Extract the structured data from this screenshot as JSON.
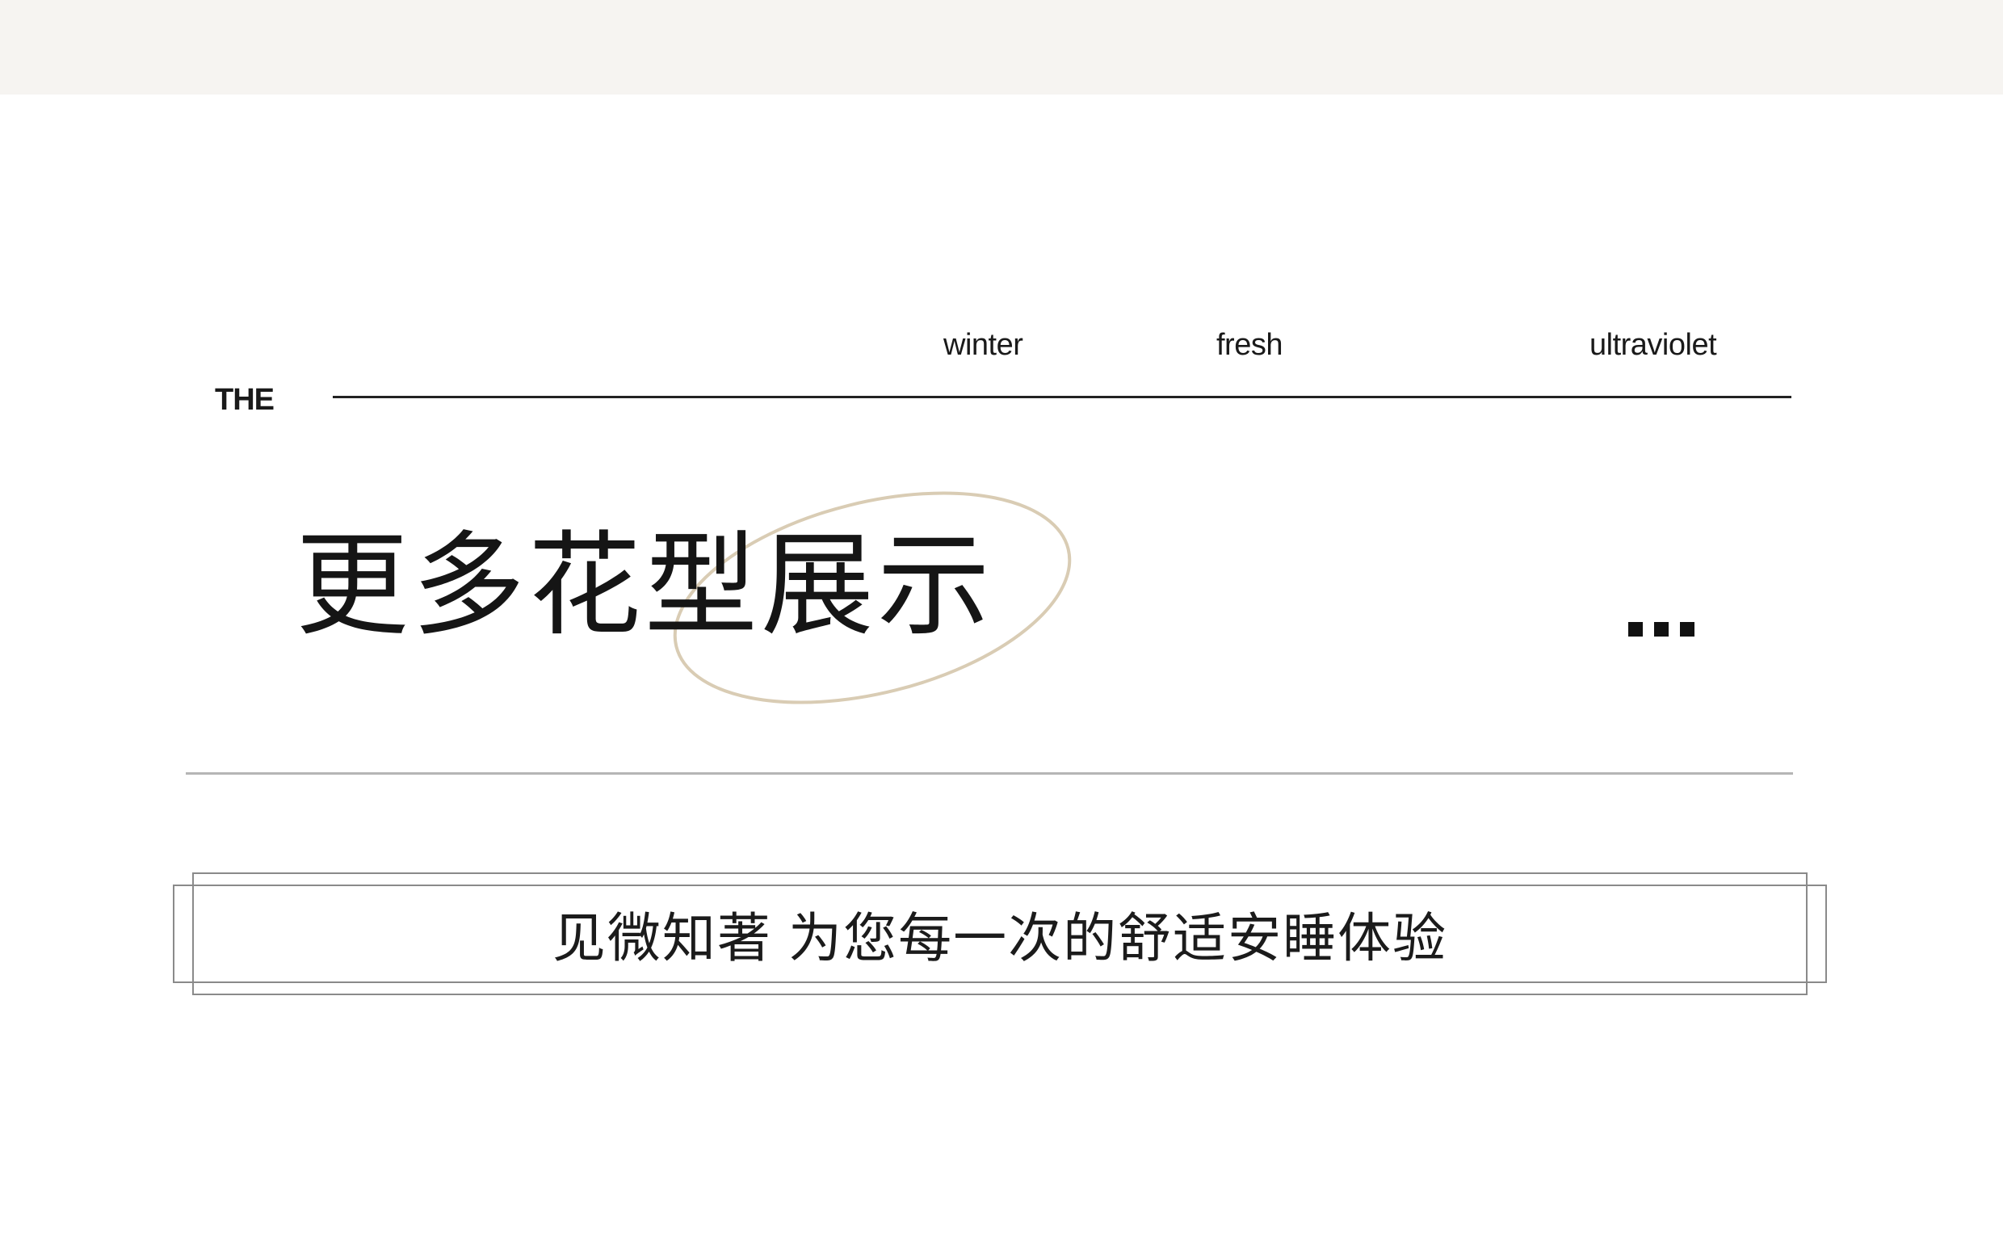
{
  "colors": {
    "top_band": "#f6f4f1",
    "ellipse_stroke": "#d9ccb4",
    "top_rule": "#222222",
    "bottom_rule": "#b5b5b5",
    "dots": "#111111"
  },
  "header": {
    "tags": [
      "winter",
      "fresh",
      "ultraviolet"
    ],
    "the_label": "THE"
  },
  "main": {
    "title": "更多花型展示",
    "more_icon": "ellipsis-icon"
  },
  "footer": {
    "slogan": "见微知著 为您每一次的舒适安睡体验"
  }
}
